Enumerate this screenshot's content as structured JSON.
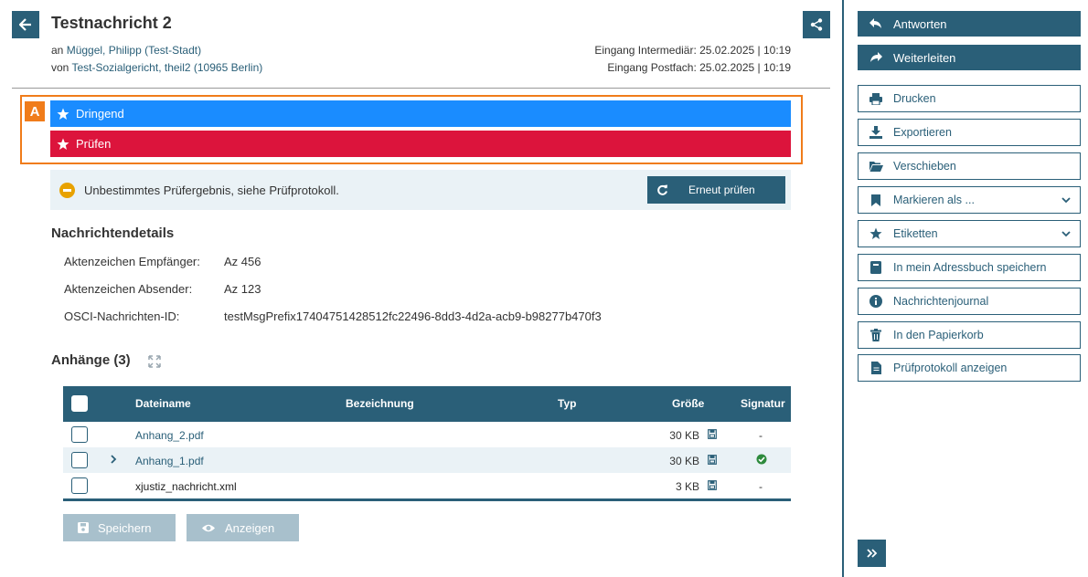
{
  "header": {
    "title": "Testnachricht 2",
    "to_prefix": "an",
    "to_name": "Müggel, Philipp (Test-Stadt)",
    "from_prefix": "von",
    "from_name": "Test-Sozialgericht, theil2 (10965 Berlin)",
    "received_intermediary": "Eingang Intermediär: 25.02.2025 | 10:19",
    "received_mailbox": "Eingang Postfach: 25.02.2025 | 10:19"
  },
  "labels": {
    "marker": "A",
    "urgent": "Dringend",
    "check": "Prüfen",
    "urgent_color": "#1a8cff",
    "check_color": "#dc143c"
  },
  "verification": {
    "message": "Unbestimmtes Prüfergebnis, siehe Prüfprotokoll.",
    "recheck_label": "Erneut prüfen"
  },
  "details": {
    "heading": "Nachrichtendetails",
    "rows": [
      {
        "label": "Aktenzeichen Empfänger:",
        "value": "Az 456"
      },
      {
        "label": "Aktenzeichen Absender:",
        "value": "Az 123"
      },
      {
        "label": "OSCI-Nachrichten-ID:",
        "value": "testMsgPrefix17404751428512fc22496-8dd3-4d2a-acb9-b98277b470f3"
      }
    ]
  },
  "attachments": {
    "heading": "Anhänge (3)",
    "columns": {
      "filename": "Dateiname",
      "description": "Bezeichnung",
      "type": "Typ",
      "size": "Größe",
      "signature": "Signatur"
    },
    "rows": [
      {
        "filename": "Anhang_2.pdf",
        "size": "30 KB",
        "signature": "-"
      },
      {
        "filename": "Anhang_1.pdf",
        "size": "30 KB",
        "signature": "check-circle-icon"
      },
      {
        "filename": "xjustiz_nachricht.xml",
        "size": "3 KB",
        "signature": "-"
      }
    ],
    "save_label": "Speichern",
    "view_label": "Anzeigen"
  },
  "sidebar": {
    "reply": "Antworten",
    "forward": "Weiterleiten",
    "print": "Drucken",
    "export": "Exportieren",
    "move": "Verschieben",
    "mark_as": "Markieren als ...",
    "tags": "Etiketten",
    "save_address": "In mein Adressbuch speichern",
    "journal": "Nachrichtenjournal",
    "trash": "In den Papierkorb",
    "protocol": "Prüfprotokoll anzeigen"
  },
  "colors": {
    "primary": "#2a5f78",
    "highlight": "#f07c1a",
    "warning": "#e8a200",
    "success": "#2e8b3d"
  }
}
